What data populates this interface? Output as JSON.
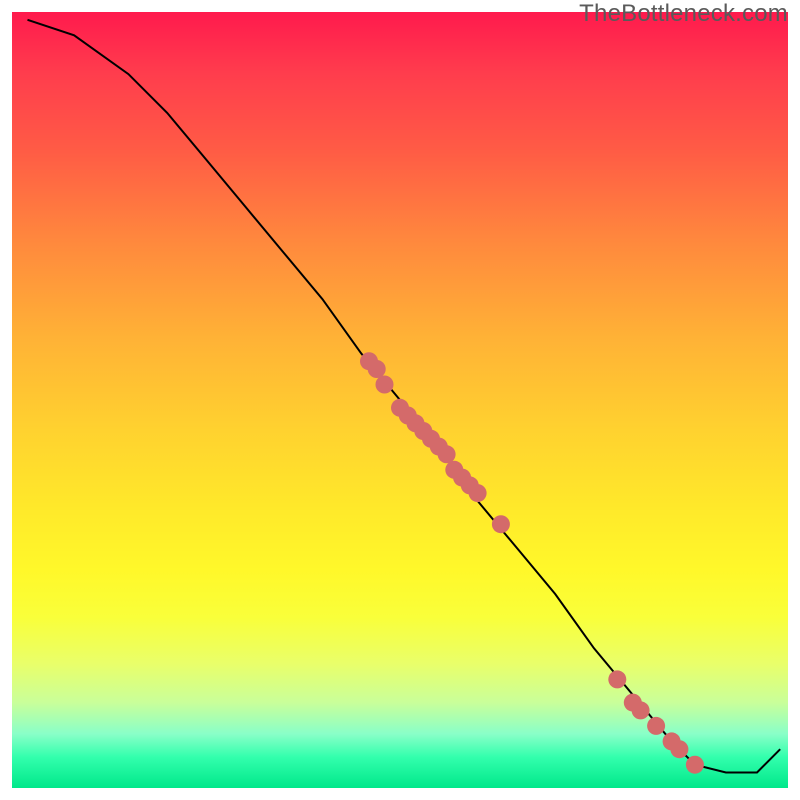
{
  "watermark": "TheBottleneck.com",
  "colors": {
    "curve": "#000000",
    "dot": "#d46a6a"
  },
  "chart_data": {
    "type": "line",
    "title": "",
    "xlabel": "",
    "ylabel": "",
    "xlim": [
      0,
      100
    ],
    "ylim": [
      0,
      100
    ],
    "curve": {
      "x": [
        2,
        8,
        15,
        20,
        25,
        30,
        35,
        40,
        45,
        50,
        55,
        60,
        65,
        70,
        75,
        80,
        85,
        88,
        92,
        96,
        99
      ],
      "y": [
        99,
        97,
        92,
        87,
        81,
        75,
        69,
        63,
        56,
        50,
        44,
        37,
        31,
        25,
        18,
        12,
        6,
        3,
        2,
        2,
        5
      ]
    },
    "series": [
      {
        "name": "points",
        "x": [
          46,
          47,
          48,
          50,
          51,
          52,
          53,
          54,
          55,
          56,
          57,
          58,
          59,
          60,
          63,
          78,
          80,
          81,
          83,
          85,
          86,
          88
        ],
        "y": [
          55,
          54,
          52,
          49,
          48,
          47,
          46,
          45,
          44,
          43,
          41,
          40,
          39,
          38,
          34,
          14,
          11,
          10,
          8,
          6,
          5,
          3
        ]
      }
    ]
  }
}
